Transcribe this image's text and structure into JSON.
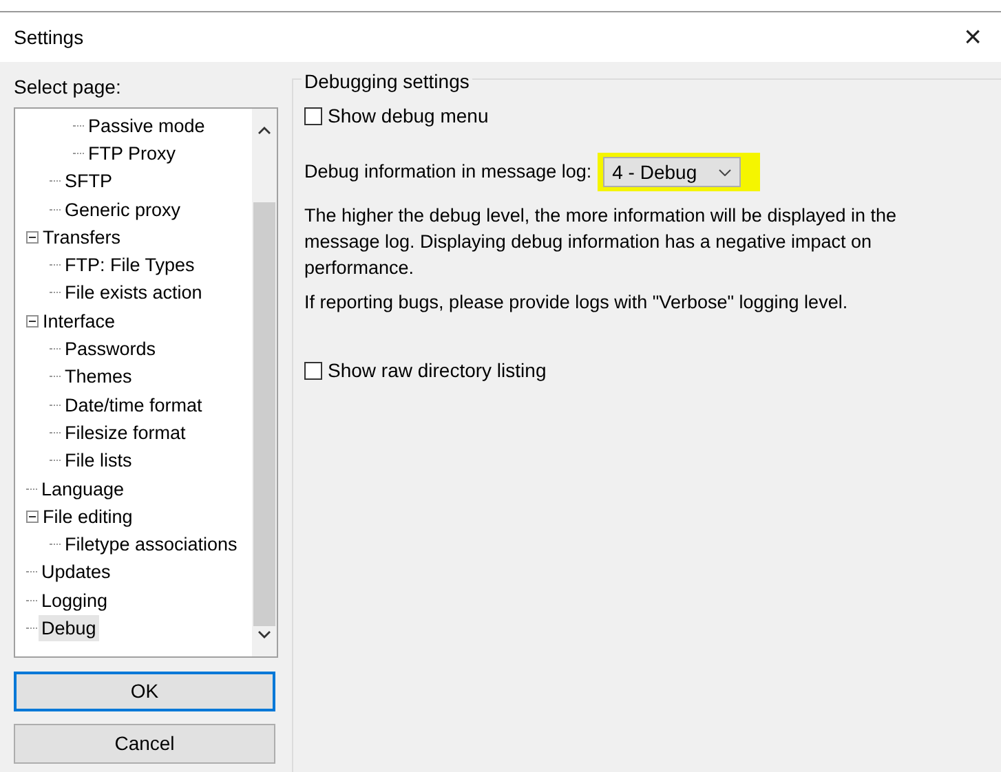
{
  "window": {
    "title": "Settings",
    "close": "×"
  },
  "sidebar": {
    "heading": "Select page:",
    "tree": [
      {
        "children": [
          {
            "children": [
              {
                "label": "Passive mode",
                "selected": false
              },
              {
                "label": "FTP Proxy",
                "selected": false
              }
            ]
          },
          {
            "label": "SFTP",
            "selected": false
          },
          {
            "label": "Generic proxy",
            "selected": false
          }
        ]
      },
      {
        "label": "Transfers",
        "selected": false,
        "expanded": true,
        "children": [
          {
            "label": "FTP: File Types",
            "selected": false
          },
          {
            "label": "File exists action",
            "selected": false
          }
        ]
      },
      {
        "label": "Interface",
        "selected": false,
        "expanded": true,
        "children": [
          {
            "label": "Passwords",
            "selected": false
          },
          {
            "label": "Themes",
            "selected": false
          },
          {
            "label": "Date/time format",
            "selected": false
          },
          {
            "label": "Filesize format",
            "selected": false
          },
          {
            "label": "File lists",
            "selected": false
          }
        ]
      },
      {
        "label": "Language",
        "selected": false
      },
      {
        "label": "File editing",
        "selected": false,
        "expanded": true,
        "children": [
          {
            "label": "Filetype associations",
            "selected": false
          }
        ]
      },
      {
        "label": "Updates",
        "selected": false
      },
      {
        "label": "Logging",
        "selected": false
      },
      {
        "label": "Debug",
        "selected": true
      }
    ]
  },
  "buttons": [
    {
      "label": "OK",
      "default": true
    },
    {
      "label": "Cancel",
      "default": false
    }
  ],
  "panel": {
    "legend": "Debugging settings",
    "items": [
      {
        "kind": "checkbox",
        "label": "Show debug menu",
        "checked": false
      },
      {
        "kind": "select",
        "label": "Debug information in message log:",
        "value": "4 - Debug",
        "highlighted": true
      },
      {
        "kind": "text",
        "text": "The higher the debug level, the more information will be displayed in the message log. Displaying debug information has a negative impact on performance."
      },
      {
        "kind": "text",
        "text": "If reporting bugs, please provide logs with \"Verbose\" logging level."
      },
      {
        "kind": "checkbox",
        "label": "Show raw directory listing",
        "checked": false
      }
    ]
  }
}
